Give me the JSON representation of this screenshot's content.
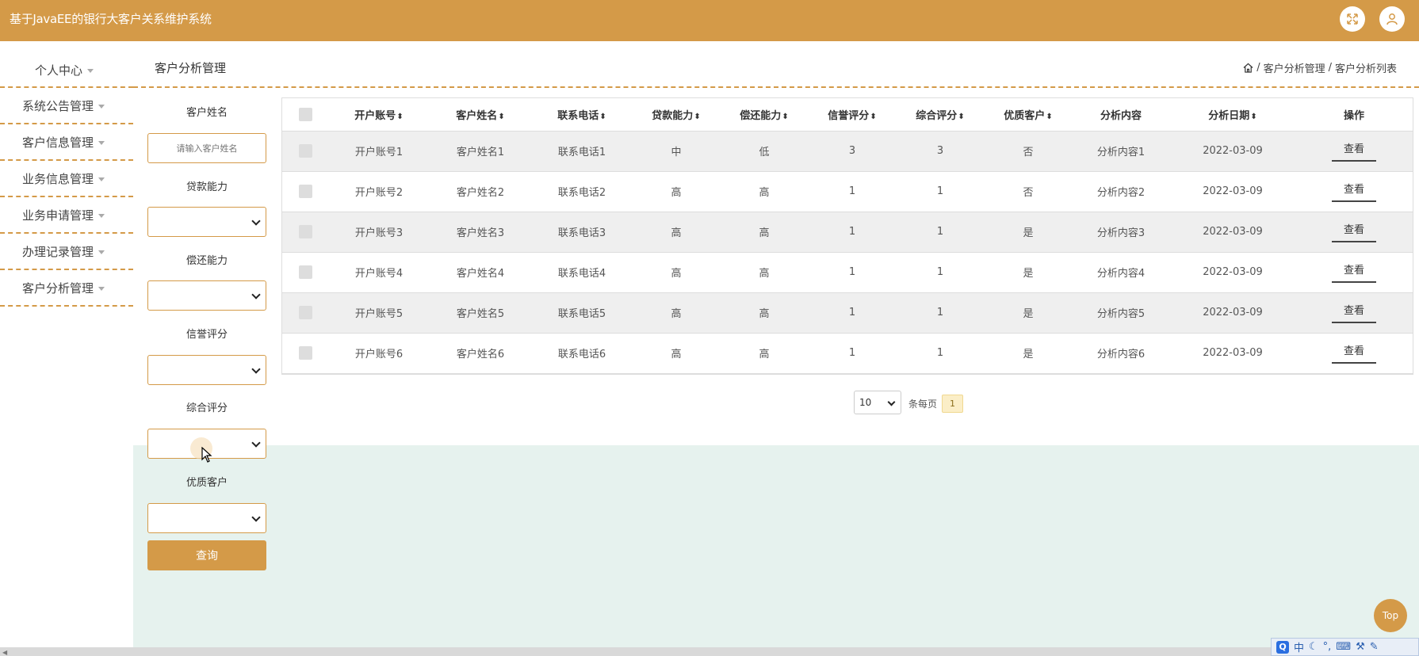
{
  "app": {
    "title": "基于JavaEE的银行大客户关系维护系统"
  },
  "sidebar": {
    "personal": "个人中心",
    "items": [
      {
        "label": "系统公告管理"
      },
      {
        "label": "客户信息管理"
      },
      {
        "label": "业务信息管理"
      },
      {
        "label": "业务申请管理"
      },
      {
        "label": "办理记录管理"
      },
      {
        "label": "客户分析管理"
      }
    ]
  },
  "header": {
    "page_title": "客户分析管理",
    "breadcrumb": {
      "sep": "/",
      "level1": "客户分析管理",
      "level2": "客户分析列表"
    }
  },
  "search": {
    "name_label": "客户姓名",
    "name_placeholder": "请输入客户姓名",
    "loan_label": "贷款能力",
    "repay_label": "偿还能力",
    "credit_label": "信誉评分",
    "overall_label": "综合评分",
    "premium_label": "优质客户",
    "query_button": "查询"
  },
  "table": {
    "columns": [
      "开户账号",
      "客户姓名",
      "联系电话",
      "贷款能力",
      "偿还能力",
      "信誉评分",
      "综合评分",
      "优质客户",
      "分析内容",
      "分析日期",
      "操作"
    ],
    "sort_icon": "⬍",
    "view_label": "查看",
    "rows": [
      [
        "开户账号1",
        "客户姓名1",
        "联系电话1",
        "中",
        "低",
        "3",
        "3",
        "否",
        "分析内容1",
        "2022-03-09"
      ],
      [
        "开户账号2",
        "客户姓名2",
        "联系电话2",
        "高",
        "高",
        "1",
        "1",
        "否",
        "分析内容2",
        "2022-03-09"
      ],
      [
        "开户账号3",
        "客户姓名3",
        "联系电话3",
        "高",
        "高",
        "1",
        "1",
        "是",
        "分析内容3",
        "2022-03-09"
      ],
      [
        "开户账号4",
        "客户姓名4",
        "联系电话4",
        "高",
        "高",
        "1",
        "1",
        "是",
        "分析内容4",
        "2022-03-09"
      ],
      [
        "开户账号5",
        "客户姓名5",
        "联系电话5",
        "高",
        "高",
        "1",
        "1",
        "是",
        "分析内容5",
        "2022-03-09"
      ],
      [
        "开户账号6",
        "客户姓名6",
        "联系电话6",
        "高",
        "高",
        "1",
        "1",
        "是",
        "分析内容6",
        "2022-03-09"
      ]
    ]
  },
  "pagination": {
    "page_size": "10",
    "per_page_label": "条每页",
    "current_page": "1"
  },
  "top_button": "Top",
  "ime": {
    "mode": "中",
    "logo": "Q"
  },
  "colors": {
    "accent": "#d49a48",
    "panel": "#e6f2ee"
  }
}
